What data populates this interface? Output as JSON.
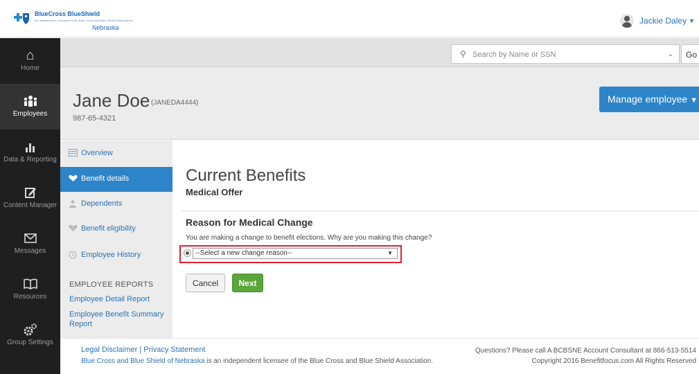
{
  "header": {
    "logo_brand": "BlueCross BlueShield",
    "logo_sub": "Nebraska",
    "logo_tagline": "An Independent Licensee of the Blue Cross and Blue Shield Association",
    "user_name": "Jackie Daley"
  },
  "nav": [
    {
      "label": "Home",
      "icon": "home-icon"
    },
    {
      "label": "Employees",
      "icon": "people-icon"
    },
    {
      "label": "Data & Reporting",
      "icon": "bar-chart-icon"
    },
    {
      "label": "Content Manager",
      "icon": "pencil-icon"
    },
    {
      "label": "Messages",
      "icon": "envelope-icon"
    },
    {
      "label": "Resources",
      "icon": "book-icon"
    },
    {
      "label": "Group Settings",
      "icon": "gears-icon"
    }
  ],
  "search": {
    "placeholder": "Search by Name or SSN",
    "go_label": "Go"
  },
  "employee": {
    "name": "Jane Doe",
    "id": "(JANEDA4444)",
    "ssn": "987-65-4321",
    "manage_label": "Manage employee"
  },
  "subnav": [
    {
      "label": "Overview",
      "active": false
    },
    {
      "label": "Benefit details",
      "active": true
    },
    {
      "label": "Dependents",
      "active": false
    },
    {
      "label": "Benefit eligibility",
      "active": false
    },
    {
      "label": "Employee History",
      "active": false
    }
  ],
  "reports": {
    "heading": "EMPLOYEE REPORTS",
    "links": [
      "Employee Detail Report",
      "Employee Benefit Summary Report"
    ]
  },
  "main": {
    "title": "Current Benefits",
    "subtitle": "Medical Offer",
    "reason_heading": "Reason for Medical Change",
    "reason_text": "You are making a change to benefit elections. Why are you making this change?",
    "select_value": "--Select a new change reason--",
    "cancel_label": "Cancel",
    "next_label": "Next"
  },
  "footer": {
    "legal": "Legal Disclaimer | Privacy Statement",
    "line2_link": "Blue Cross and Blue Shield of Nebraska",
    "line2_rest": " is an independent licensee of the Blue Cross and Blue Shield Association.",
    "questions": "Questions? Please call A BCBSNE Account Consultant at 866-513-5514",
    "copyright": "Copyright 2016 Benefitfocus.com All Rights Reserved"
  }
}
